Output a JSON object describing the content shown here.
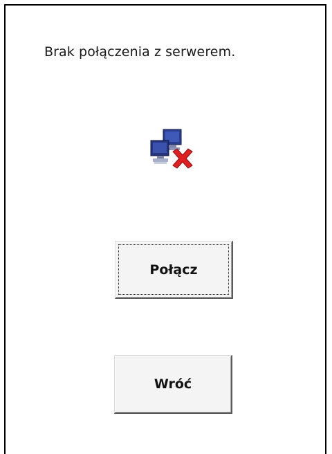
{
  "dialog": {
    "message": "Brak połączenia z serwerem.",
    "status_icon": "network-disconnected-icon"
  },
  "buttons": {
    "connect_label": "Połącz",
    "back_label": "Wróć"
  },
  "colors": {
    "accent_error": "#e02020",
    "monitor_blue": "#2c3e8f"
  }
}
